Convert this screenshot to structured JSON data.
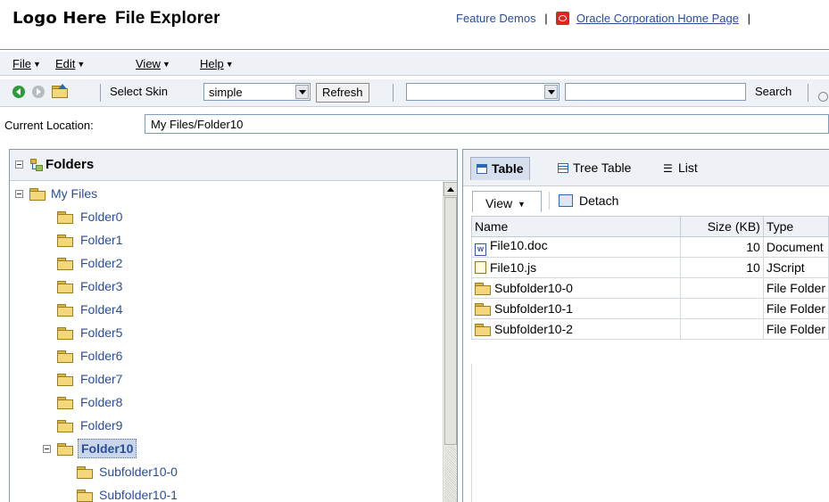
{
  "header": {
    "logo_text": "Logo Here",
    "app_title": "File Explorer",
    "feature_demos_link": "Feature Demos",
    "separator": "|",
    "oracle_link": "Oracle Corporation Home Page"
  },
  "menubar": {
    "items": [
      {
        "label": "File"
      },
      {
        "label": "Edit"
      },
      {
        "label": "View"
      },
      {
        "label": "Help"
      }
    ]
  },
  "toolbar": {
    "select_skin_label": "Select Skin",
    "skin_value": "simple",
    "refresh_label": "Refresh",
    "location_select_value": "",
    "search_value": "",
    "search_label": "Search"
  },
  "location": {
    "label": "Current Location:",
    "value": "My Files/Folder10"
  },
  "folders_panel": {
    "title": "Folders",
    "root": "My Files",
    "items": [
      "Folder0",
      "Folder1",
      "Folder2",
      "Folder3",
      "Folder4",
      "Folder5",
      "Folder6",
      "Folder7",
      "Folder8",
      "Folder9"
    ],
    "selected": "Folder10",
    "subitems": [
      "Subfolder10-0",
      "Subfolder10-1"
    ]
  },
  "content_panel": {
    "tabs": [
      {
        "label": "Table",
        "selected": true
      },
      {
        "label": "Tree Table",
        "selected": false
      },
      {
        "label": "List",
        "selected": false
      }
    ],
    "view_label": "View",
    "detach_label": "Detach",
    "columns": [
      "Name",
      "Size (KB)",
      "Type"
    ],
    "rows": [
      {
        "icon": "word-doc-icon",
        "name": "File10.doc",
        "size": "10",
        "type": "Document"
      },
      {
        "icon": "js-file-icon",
        "name": "File10.js",
        "size": "10",
        "type": "JScript"
      },
      {
        "icon": "folder-icon",
        "name": "Subfolder10-0",
        "size": "",
        "type": "File Folder"
      },
      {
        "icon": "folder-icon",
        "name": "Subfolder10-1",
        "size": "",
        "type": "File Folder"
      },
      {
        "icon": "folder-icon",
        "name": "Subfolder10-2",
        "size": "",
        "type": "File Folder"
      }
    ]
  },
  "colors": {
    "link_blue": "#2a4d9b",
    "panel_header_bg": "#eef1f5",
    "selected_node_bg": "#c9d5e8",
    "oracle_red": "#e2251b",
    "back_button_green": "#2e9b3a"
  }
}
